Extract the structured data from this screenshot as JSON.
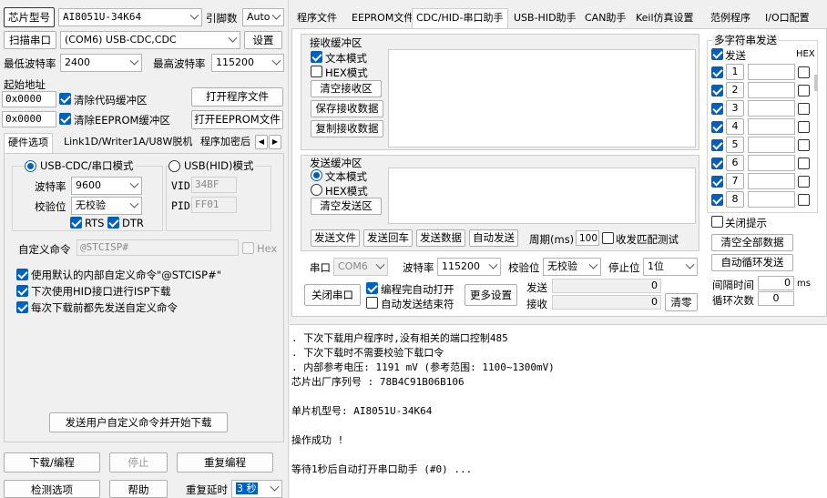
{
  "chip": {
    "label": "芯片型号",
    "model": "AI8051U-34K64",
    "pin_label": "引脚数",
    "pin_value": "Auto"
  },
  "port": {
    "scan_label": "扫描串口",
    "value": "(COM6) USB-CDC,CDC",
    "settings_label": "设置"
  },
  "baud": {
    "min_label": "最低波特率",
    "min_value": "2400",
    "max_label": "最高波特率",
    "max_value": "115200"
  },
  "addr": {
    "title": "起始地址",
    "addr1": "0x0000",
    "clear_code": "清除代码缓冲区",
    "open_program": "打开程序文件",
    "addr2": "0x0000",
    "clear_eeprom": "清除EEPROM缓冲区",
    "open_eeprom": "打开EEPROM文件"
  },
  "left_tabs": [
    "硬件选项",
    "Link1D/Writer1A/U8W脱机",
    "程序加密后"
  ],
  "hw": {
    "mode_cdc": "USB-CDC/串口模式",
    "mode_hid": "USB(HID)模式",
    "baud_label": "波特率",
    "baud_value": "9600",
    "parity_label": "校验位",
    "parity_value": "无校验",
    "rts": "RTS",
    "dtr": "DTR",
    "vid_label": "VID",
    "vid_value": "34BF",
    "pid_label": "PID",
    "pid_value": "FF01",
    "custom_label": "自定义命令",
    "custom_value": "@STCISP#",
    "hex_label": "Hex",
    "opt1": "使用默认的内部自定义命令\"@STCISP#\"",
    "opt2": "下次使用HID接口进行ISP下载",
    "opt3": "每次下载前都先发送自定义命令",
    "send_custom": "发送用户自定义命令并开始下载"
  },
  "bottom": {
    "download": "下载/编程",
    "stop": "停止",
    "reprogram": "重复编程",
    "check": "检测选项",
    "help": "帮助",
    "delay_label": "重复延时",
    "delay_value": "3 秒"
  },
  "right_tabs": [
    "程序文件",
    "EEPROM文件",
    "CDC/HID-串口助手",
    "USB-HID助手",
    "CAN助手",
    "Keil仿真设置",
    "范例程序",
    "I/O口配置"
  ],
  "rx": {
    "title": "接收缓冲区",
    "text_mode": "文本模式",
    "hex_mode": "HEX模式",
    "clear": "清空接收区",
    "save": "保存接收数据",
    "copy": "复制接收数据"
  },
  "tx": {
    "title": "发送缓冲区",
    "text_mode": "文本模式",
    "hex_mode": "HEX模式",
    "clear": "清空发送区",
    "send_file": "发送文件",
    "send_enter": "发送回车",
    "send_data": "发送数据",
    "auto_send": "自动发送",
    "period_label": "周期(ms)",
    "period_value": "100",
    "match_test": "收发匹配测试"
  },
  "serial": {
    "port_label": "串口",
    "port_value": "COM6",
    "baud_label": "波特率",
    "baud_value": "115200",
    "parity_label": "校验位",
    "parity_value": "无校验",
    "stop_label": "停止位",
    "stop_value": "1位",
    "close": "关闭串口",
    "auto_open": "编程完自动打开",
    "auto_end": "自动发送结束符",
    "more": "更多设置",
    "send_label": "发送",
    "send_count": "0",
    "recv_label": "接收",
    "recv_count": "0",
    "clear_zero": "清零"
  },
  "multi": {
    "title": "多字符串发送",
    "send_label": "发送",
    "hex_label": "HEX",
    "rows": [
      "1",
      "2",
      "3",
      "4",
      "5",
      "6",
      "7",
      "8"
    ],
    "close_tip": "关闭提示",
    "clear_all": "清空全部数据",
    "auto_loop": "自动循环发送",
    "interval_label": "间隔时间",
    "interval_value": "0",
    "interval_unit": "ms",
    "loop_label": "循环次数",
    "loop_value": "0"
  },
  "log": [
    "  . 下次下载用户程序时,没有相关的端口控制485",
    "  . 下次下载时不需要校验下载口令",
    "  . 内部参考电压: 1191 mV (参考范围: 1100~1300mV)",
    "芯片出厂序列号 : 78B4C91B06B106",
    "",
    "  单片机型号: AI8051U-34K64",
    "",
    "操作成功 !",
    "",
    "等待1秒后自动打开串口助手 (#0) ..."
  ]
}
